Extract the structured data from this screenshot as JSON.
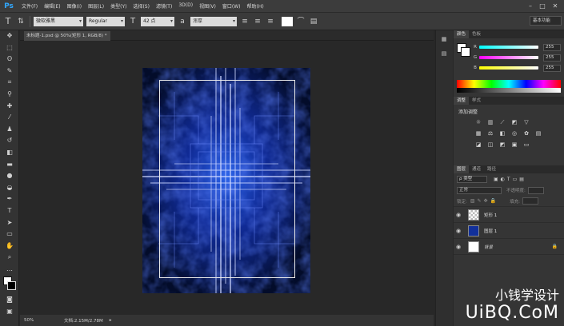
{
  "app": {
    "logo": "Ps"
  },
  "menu": [
    "文件(F)",
    "编辑(E)",
    "图像(I)",
    "图层(L)",
    "类型(Y)",
    "选择(S)",
    "滤镜(T)",
    "3D(D)",
    "视图(V)",
    "窗口(W)",
    "帮助(H)"
  ],
  "window_controls": [
    "–",
    "□",
    "✕"
  ],
  "options": {
    "tool_icon": "T",
    "font_family": "微软雅黑",
    "font_style": "Regular",
    "font_size": "42 点",
    "antialias": "浑厚"
  },
  "workspace": "基本功能",
  "document": {
    "tab_title": "未标题-1.psd @ 50%(矩形 1, RGB/8) *",
    "zoom": "50%",
    "doc_info": "文档:2.15M/2.78M"
  },
  "color_panel": {
    "tabs": [
      "颜色",
      "色板"
    ],
    "sliders": [
      {
        "label": "R",
        "value": "255",
        "color": "#ff0000"
      },
      {
        "label": "G",
        "value": "255",
        "color": "#00ff00"
      },
      {
        "label": "B",
        "value": "255",
        "color": "#0000ff"
      }
    ]
  },
  "adjust_panel": {
    "tabs": [
      "调整",
      "样式"
    ],
    "title": "添加调整"
  },
  "layers_panel": {
    "tabs": [
      "图层",
      "通道",
      "路径"
    ],
    "filter": "ρ 类型",
    "blend_mode": "正常",
    "opacity_label": "不透明度:",
    "lock_label": "锁定:",
    "fill_label": "填充:",
    "layers": [
      {
        "name": "矩形 1"
      },
      {
        "name": "图层 1"
      },
      {
        "name": "背景"
      }
    ]
  },
  "watermark": {
    "line1": "小钱学设计",
    "line2": "UiBQ.CoM"
  },
  "colors": {
    "accent": "#31a8ff",
    "artwork_blue": "#1a3fd4"
  }
}
